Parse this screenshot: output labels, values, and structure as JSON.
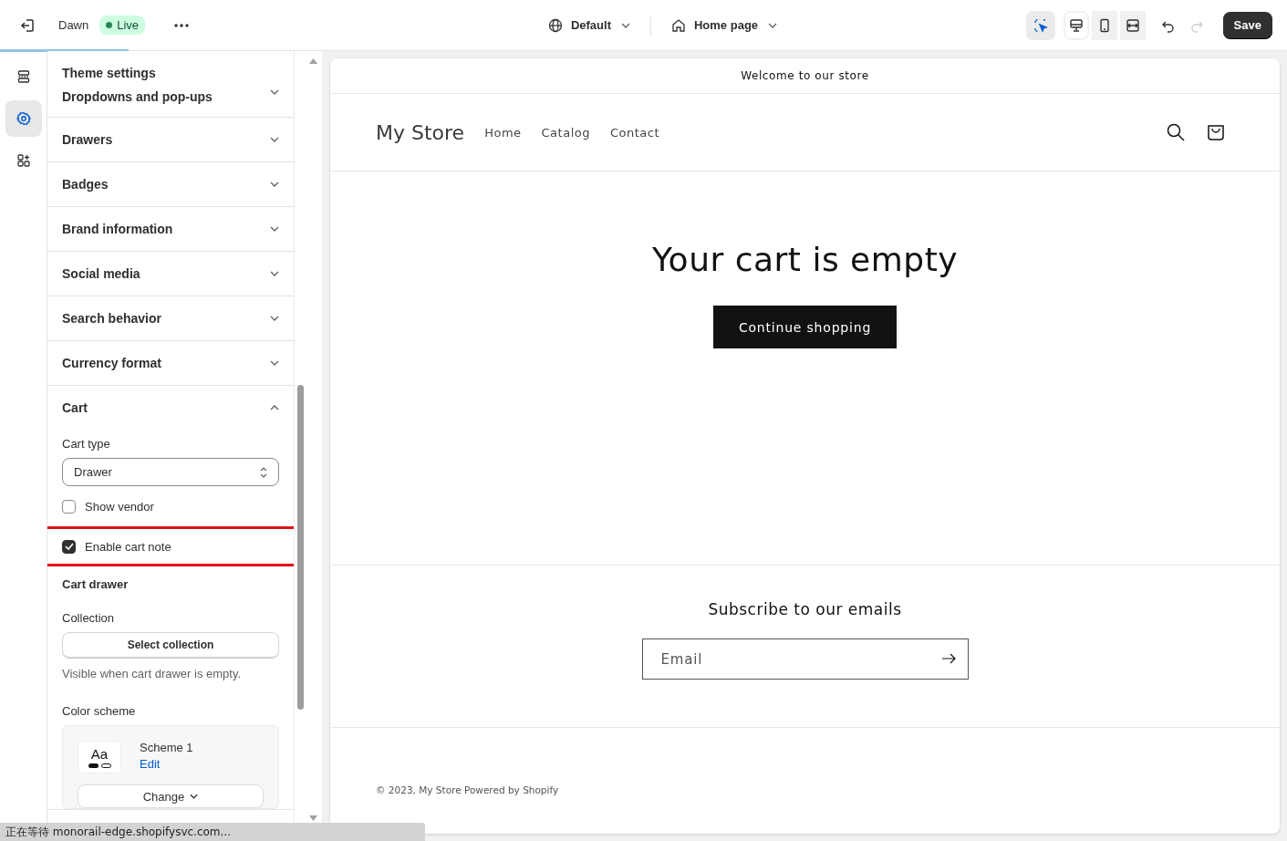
{
  "topbar": {
    "theme_name": "Dawn",
    "status_badge": "Live",
    "template": "Default",
    "page": "Home page",
    "tools": [
      {
        "kind": "inspector",
        "selected": true
      },
      {
        "kind": "desktop",
        "selected": true
      },
      {
        "kind": "mobile",
        "selected": false
      },
      {
        "kind": "fullwidth",
        "selected": false
      }
    ],
    "save_label": "Save",
    "loading": {
      "level": 0.1
    }
  },
  "rail": [
    {
      "kind": "sections",
      "selected": false
    },
    {
      "kind": "settings",
      "selected": true
    },
    {
      "kind": "apps",
      "selected": false
    }
  ],
  "panel": {
    "title": "Theme settings",
    "sections": [
      {
        "label": "Dropdowns and pop-ups",
        "expanded": false
      },
      {
        "label": "Drawers",
        "expanded": false
      },
      {
        "label": "Badges",
        "expanded": false
      },
      {
        "label": "Brand information",
        "expanded": false
      },
      {
        "label": "Social media",
        "expanded": false
      },
      {
        "label": "Search behavior",
        "expanded": false
      },
      {
        "label": "Currency format",
        "expanded": false
      },
      {
        "label": "Cart",
        "expanded": true
      }
    ],
    "cart_settings": [
      {
        "kind": "select",
        "label": "Cart type",
        "value": "Drawer"
      },
      {
        "kind": "checkbox",
        "label": "Show vendor",
        "checked": false,
        "highlighted": false
      },
      {
        "kind": "checkbox",
        "label": "Enable cart note",
        "checked": true,
        "highlighted": true
      },
      {
        "kind": "heading",
        "label": "Cart drawer"
      },
      {
        "kind": "picker",
        "label": "Collection",
        "button": "Select collection",
        "help": "Visible when cart drawer is empty."
      },
      {
        "kind": "scheme",
        "label": "Color scheme",
        "sample": "Aa",
        "name": "Scheme 1",
        "edit": "Edit",
        "change": "Change"
      }
    ]
  },
  "preview": {
    "announcement": "Welcome to our store",
    "logo": "My Store",
    "nav": [
      "Home",
      "Catalog",
      "Contact"
    ],
    "cart_heading": "Your cart is empty",
    "continue_button": "Continue shopping",
    "subscribe_heading": "Subscribe to our emails",
    "email_placeholder": "Email",
    "footer": "© 2023, My Store Powered by Shopify"
  },
  "status_bar": "正在等待 monorail-edge.shopifysvc.com..."
}
